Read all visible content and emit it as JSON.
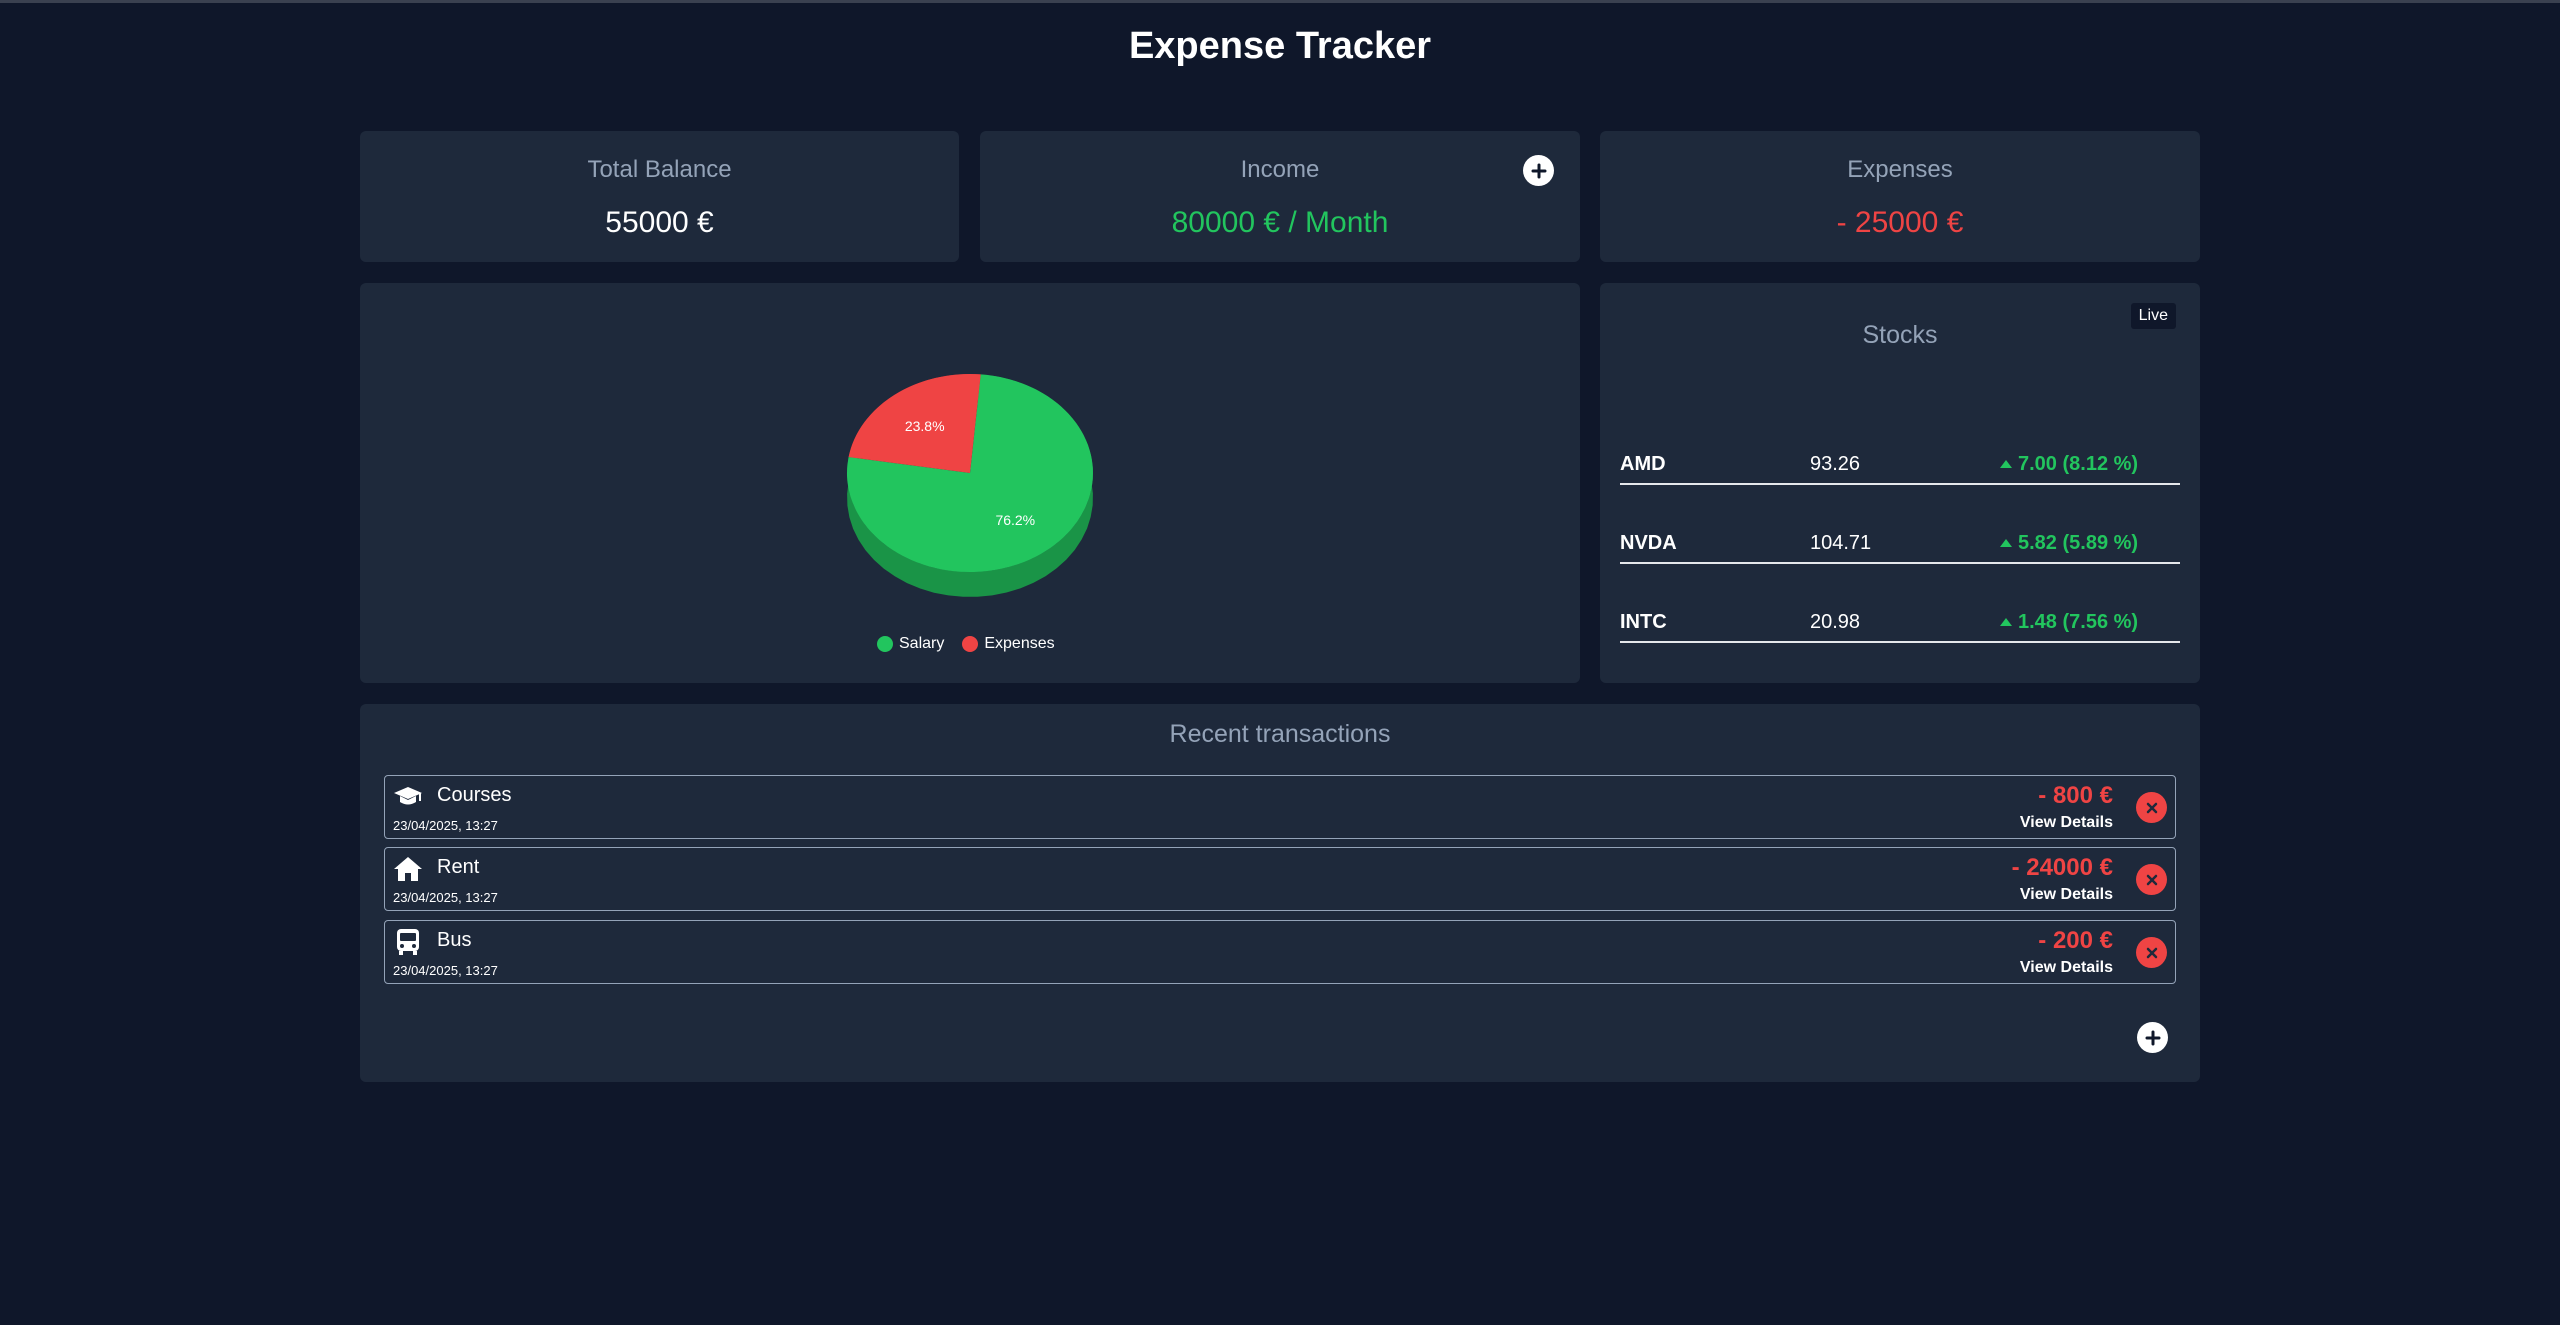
{
  "app": {
    "title": "Expense Tracker"
  },
  "summary": {
    "balance": {
      "label": "Total Balance",
      "value": "55000 €"
    },
    "income": {
      "label": "Income",
      "value": "80000 € / Month",
      "add_icon": "plus-icon"
    },
    "expenses": {
      "label": "Expenses",
      "value": "- 25000 €"
    }
  },
  "chart_data": {
    "type": "pie",
    "categories": [
      "Salary",
      "Expenses"
    ],
    "values": [
      76.2,
      23.8
    ],
    "labels": [
      "76.2%",
      "23.8%"
    ],
    "colors": [
      "#22c55e",
      "#ef4444"
    ],
    "legend_position": "bottom"
  },
  "stocks": {
    "title": "Stocks",
    "live_label": "Live",
    "items": [
      {
        "symbol": "AMD",
        "price": "93.26",
        "change": "7.00 (8.12 %)"
      },
      {
        "symbol": "NVDA",
        "price": "104.71",
        "change": "5.82 (5.89 %)"
      },
      {
        "symbol": "INTC",
        "price": "20.98",
        "change": "1.48 (7.56 %)"
      }
    ]
  },
  "transactions": {
    "title": "Recent transactions",
    "details_label": "View Details",
    "items": [
      {
        "icon": "graduation-cap-icon",
        "name": "Courses",
        "date": "23/04/2025, 13:27",
        "amount": "- 800 €"
      },
      {
        "icon": "home-icon",
        "name": "Rent",
        "date": "23/04/2025, 13:27",
        "amount": "- 24000 €"
      },
      {
        "icon": "bus-icon",
        "name": "Bus",
        "date": "23/04/2025, 13:27",
        "amount": "- 200 €"
      }
    ]
  },
  "colors": {
    "background": "#0f172a",
    "card": "#1e293b",
    "positive": "#22c55e",
    "negative": "#ef4444",
    "muted": "#94a3b8"
  }
}
